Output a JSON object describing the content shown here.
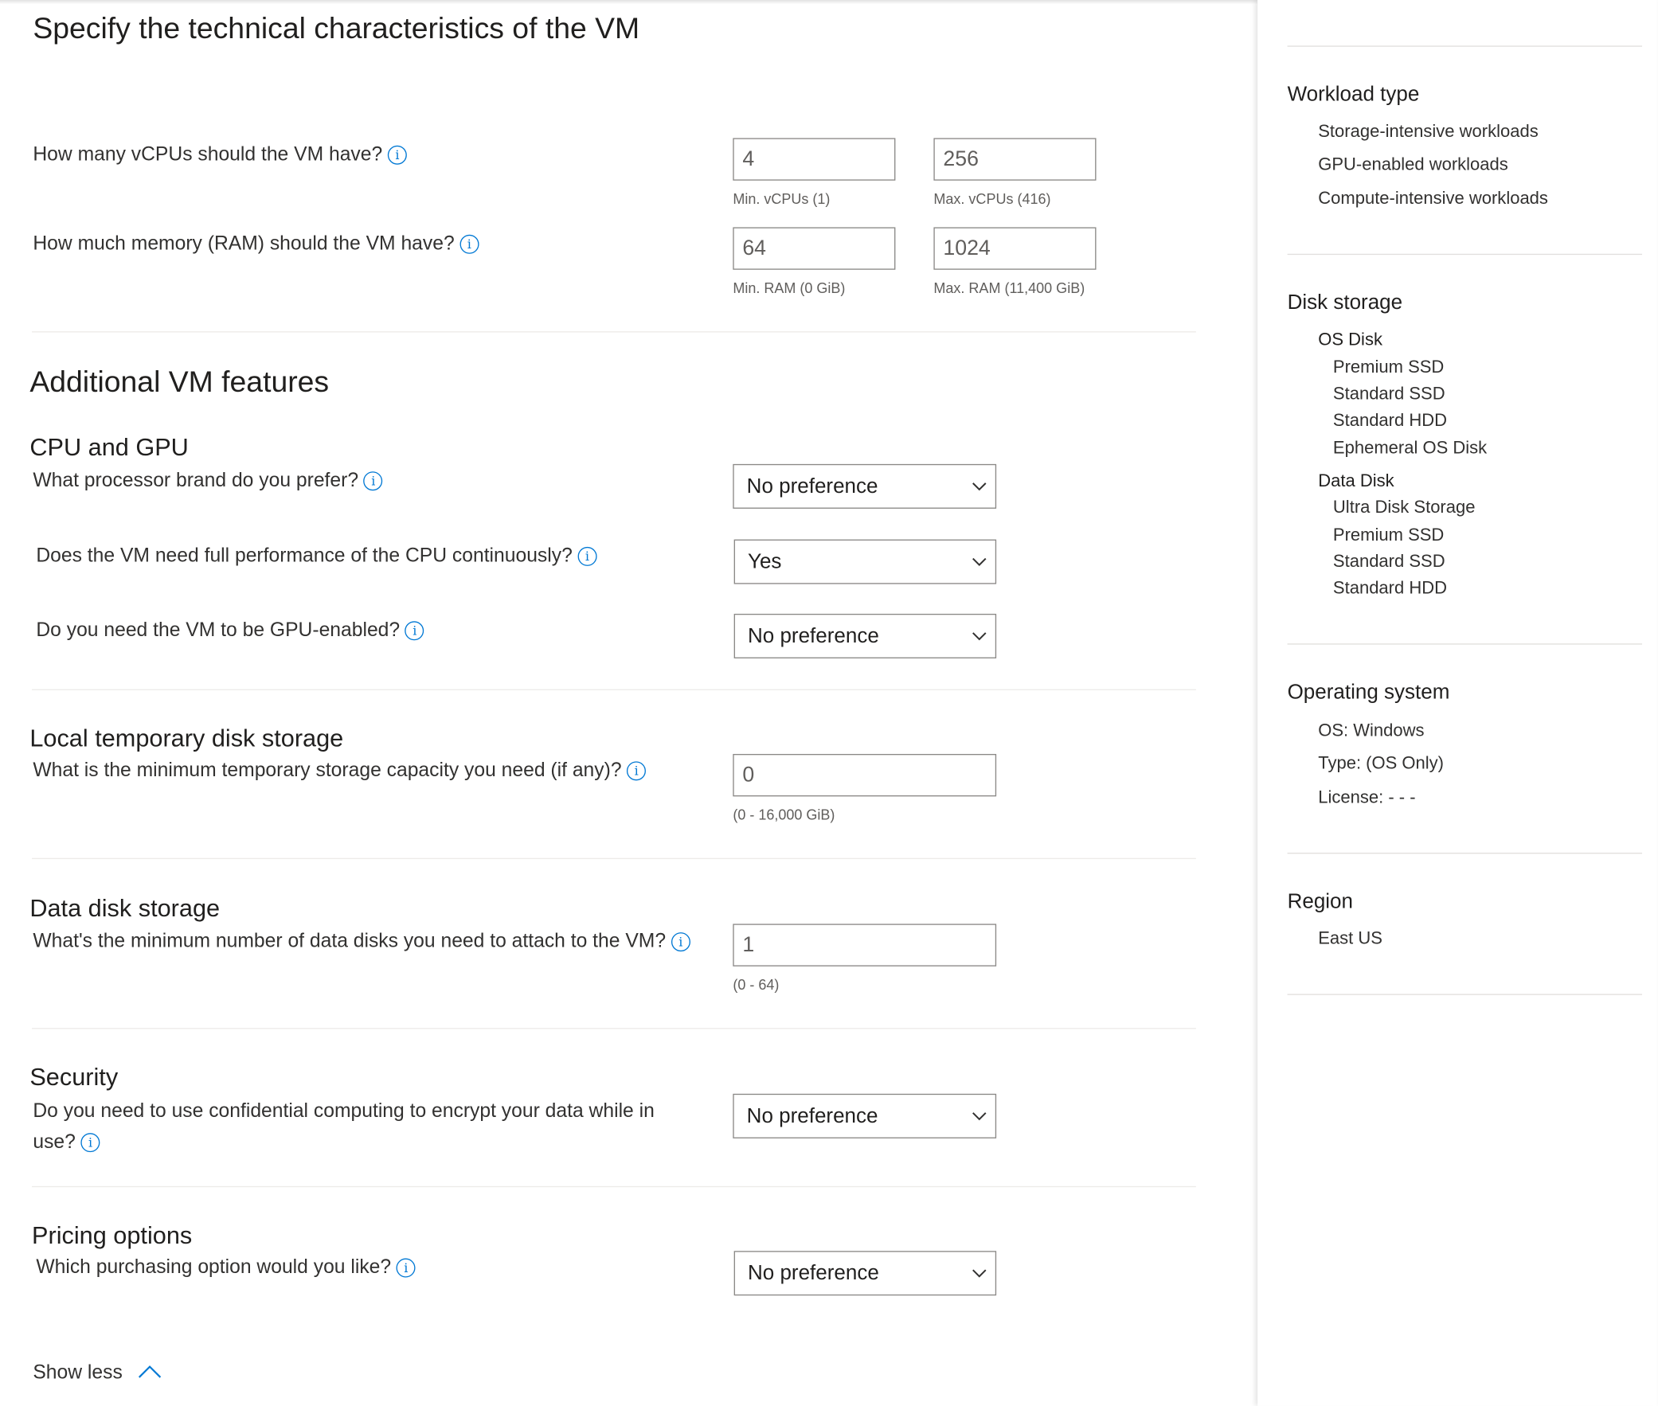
{
  "page": {
    "title": "Specify the technical characteristics of the VM",
    "vcpu": {
      "question": "How many vCPUs should the VM have?",
      "min_value": "4",
      "max_value": "256",
      "min_hint": "Min. vCPUs (1)",
      "max_hint": "Max. vCPUs (416)"
    },
    "ram": {
      "question": "How much memory (RAM) should the VM have?",
      "min_value": "64",
      "max_value": "1024",
      "min_hint": "Min. RAM (0 GiB)",
      "max_hint": "Max. RAM (11,400 GiB)"
    },
    "additional_title": "Additional VM features",
    "cpu_gpu": {
      "heading": "CPU and GPU",
      "q_brand": "What processor brand do you prefer?",
      "brand_value": "No preference",
      "q_perf": "Does the VM need full performance of the CPU continuously?",
      "perf_value": "Yes",
      "q_gpu": "Do you need the VM to be GPU-enabled?",
      "gpu_value": "No preference"
    },
    "temp_disk": {
      "heading": "Local temporary disk storage",
      "question": "What is the minimum temporary storage capacity you need (if any)?",
      "value": "0",
      "hint": "(0 - 16,000 GiB)"
    },
    "data_disk": {
      "heading": "Data disk storage",
      "question": "What's the minimum number of data disks you need to attach to the VM?",
      "value": "1",
      "hint": "(0 - 64)"
    },
    "security": {
      "heading": "Security",
      "question": "Do you need to use confidential computing to encrypt your data while in use?",
      "value": "No preference"
    },
    "pricing": {
      "heading": "Pricing options",
      "question": "Which purchasing option would you like?",
      "value": "No preference"
    },
    "show_less": "Show less"
  },
  "sidebar": {
    "workload": {
      "title": "Workload type",
      "items": [
        "Storage-intensive workloads",
        "GPU-enabled workloads",
        "Compute-intensive workloads"
      ]
    },
    "disk": {
      "title": "Disk storage",
      "os_disk_label": "OS Disk",
      "os_items": [
        "Premium SSD",
        "Standard SSD",
        "Standard HDD",
        "Ephemeral OS Disk"
      ],
      "data_disk_label": "Data Disk",
      "data_items": [
        "Ultra Disk Storage",
        "Premium SSD",
        "Standard SSD",
        "Standard HDD"
      ]
    },
    "os": {
      "title": "Operating system",
      "items": [
        "OS: Windows",
        "Type: (OS Only)",
        "License: - - -"
      ]
    },
    "region": {
      "title": "Region",
      "items": [
        "East US"
      ]
    }
  },
  "colors": {
    "accent": "#0078d4",
    "text": "#201f1e",
    "muted": "#605e5c",
    "border": "#8a8886"
  },
  "icons": [
    "info-icon",
    "chevron-down-icon",
    "chevron-up-icon"
  ]
}
